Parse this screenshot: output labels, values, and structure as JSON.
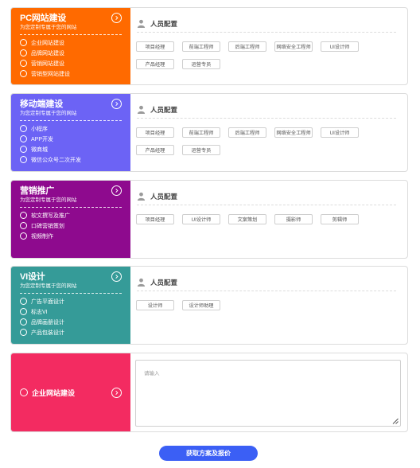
{
  "sections": [
    {
      "title": "PC网站建设",
      "subtitle": "为您定制专属于您的网站",
      "color": "#ff6a00",
      "options": [
        "企业网站建设",
        "品牌网站建设",
        "营销网站建设",
        "营销型网站建设"
      ],
      "staff_label": "人员配置",
      "tags": [
        "项目经理",
        "前端工程师",
        "后端工程师",
        "网络安全工程师",
        "UI设计师",
        "产品经理",
        "运营专员"
      ]
    },
    {
      "title": "移动端建设",
      "subtitle": "为您定制专属于您的网站",
      "color": "#6c63f5",
      "options": [
        "小程序",
        "APP开发",
        "微商城",
        "微信公众号二次开发"
      ],
      "staff_label": "人员配置",
      "tags": [
        "项目经理",
        "前端工程师",
        "后端工程师",
        "网络安全工程师",
        "UI设计师",
        "产品经理",
        "运营专员"
      ]
    },
    {
      "title": "营销推广",
      "subtitle": "为您定制专属于您的网站",
      "color": "#8e0a8e",
      "options": [
        "软文撰写及推广",
        "口碑营销策划",
        "视频制作"
      ],
      "staff_label": "人员配置",
      "tags": [
        "项目经理",
        "UI设计师",
        "文案策划",
        "摄影师",
        "剪辑师"
      ]
    },
    {
      "title": "VI设计",
      "subtitle": "为您定制专属于您的网站",
      "color": "#359b98",
      "options": [
        "广告平面设计",
        "标志VI",
        "品牌画册设计",
        "产品包装设计"
      ],
      "staff_label": "人员配置",
      "tags": [
        "设计师",
        "设计师助理"
      ]
    }
  ],
  "last": {
    "option": "企业网站建设",
    "color": "#f32b61",
    "placeholder": "请输入"
  },
  "submit_label": "获取方案及报价"
}
